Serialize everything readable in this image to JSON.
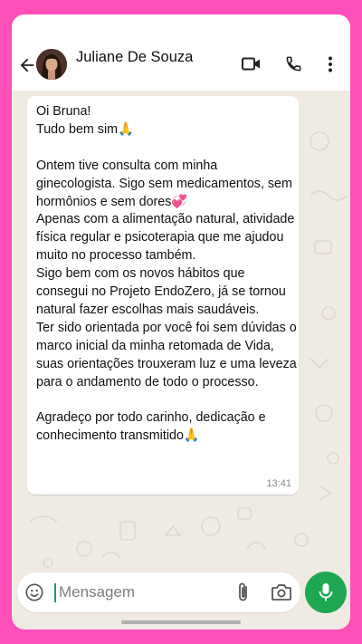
{
  "header": {
    "contact_name": "Juliane De Souza",
    "icons": [
      "back-arrow-icon",
      "video-call-icon",
      "voice-call-icon",
      "more-options-icon"
    ]
  },
  "message": {
    "text": "Oi Bruna!\nTudo bem sim🙏\n\nOntem tive consulta com minha ginecologista. Sigo sem medicamentos, sem hormônios e sem dores💞\nApenas com a alimentação natural, atividade física regular e psicoterapia que me ajudou muito no processo também.\nSigo bem com os novos hábitos que consegui no Projeto EndoZero, já se tornou natural fazer escolhas mais saudáveis.\nTer sido orientada por você foi sem dúvidas o marco inicial da minha retomada de Vida, suas orientações trouxeram luz e uma leveza para o andamento de todo o processo.\n\nAgradeço por todo carinho, dedicação e conhecimento transmitido🙏",
    "time": "13:41"
  },
  "composer": {
    "placeholder": "Mensagem",
    "value": "",
    "icons": [
      "emoji-icon",
      "attach-icon",
      "camera-icon",
      "mic-icon"
    ]
  },
  "colors": {
    "frame": "#ff4fb9",
    "chat_background": "#efeae2",
    "accent_green": "#1da851"
  }
}
